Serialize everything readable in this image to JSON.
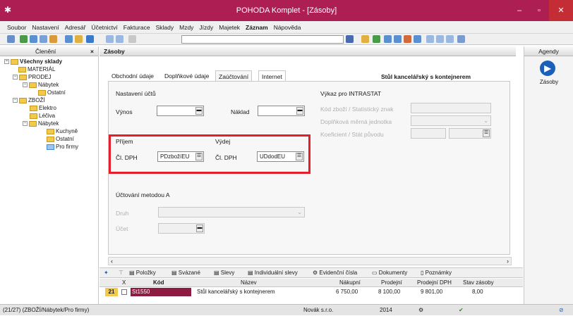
{
  "window": {
    "title": "POHODA Komplet - [Zásoby]",
    "minimize": "–",
    "maximize": "▫",
    "close": "✕"
  },
  "menu": [
    "Soubor",
    "Nastavení",
    "Adresář",
    "Účetnictví",
    "Fakturace",
    "Sklady",
    "Mzdy",
    "Jízdy",
    "Majetek",
    "Záznam",
    "Nápověda"
  ],
  "left_panel": {
    "title": "Členění",
    "close": "×",
    "tree": [
      "Všechny sklady",
      "MATERIÁL",
      "PRODEJ",
      "Nábytek",
      "Ostatní",
      "ZBOŽÍ",
      "Elektro",
      "Léčiva",
      "Nábytek",
      "Kuchyně",
      "Ostatní",
      "Pro firmy"
    ]
  },
  "center_title": "Zásoby",
  "right_panel": {
    "title": "Agendy",
    "item": "Zásoby"
  },
  "tabs": [
    "Obchodní údaje",
    "Doplňkové údaje",
    "Zaúčtování",
    "Internet"
  ],
  "product_title": "Stůl kancelářský s kontejnerem",
  "form": {
    "nastaveni_uctu": "Nastavení účtů",
    "vynos": "Výnos",
    "naklad": "Náklad",
    "prijem": "Příjem",
    "vydej": "Výdej",
    "cl_dph": "Čl. DPH",
    "prijem_value": "PDzbožíEU",
    "vydej_value": "UDdodEU",
    "uctovani": "Účtování metodou A",
    "druh": "Druh",
    "ucet": "Účet",
    "intrastat": "Výkaz pro INTRASTAT",
    "intrastat_rows": [
      "Kód zboží / Statistický znak",
      "Doplňková měrná jednotka",
      "Koeficient / Stát původu"
    ]
  },
  "bottom_tabs": [
    "Položky",
    "Svázané",
    "Slevy",
    "Individuální slevy",
    "Evidenční čísla",
    "Dokumenty",
    "Poznámky"
  ],
  "grid": {
    "headers": [
      "X",
      "Kód",
      "Název",
      "Nákupní",
      "Prodejní",
      "Prodejní DPH",
      "Stav zásoby"
    ],
    "row": {
      "num": "21",
      "code": "St1550",
      "name": "Stůl kancelářský s kontejnerem",
      "nakupni": "6 750,00",
      "prodejni": "8 100,00",
      "prodejni_dph": "9 801,00",
      "stav": "8,00"
    }
  },
  "status": {
    "path": "(21/27) (ZBOŽÍ/Nábytek/Pro firmy)",
    "company": "Novák s.r.o.",
    "year": "2014"
  }
}
